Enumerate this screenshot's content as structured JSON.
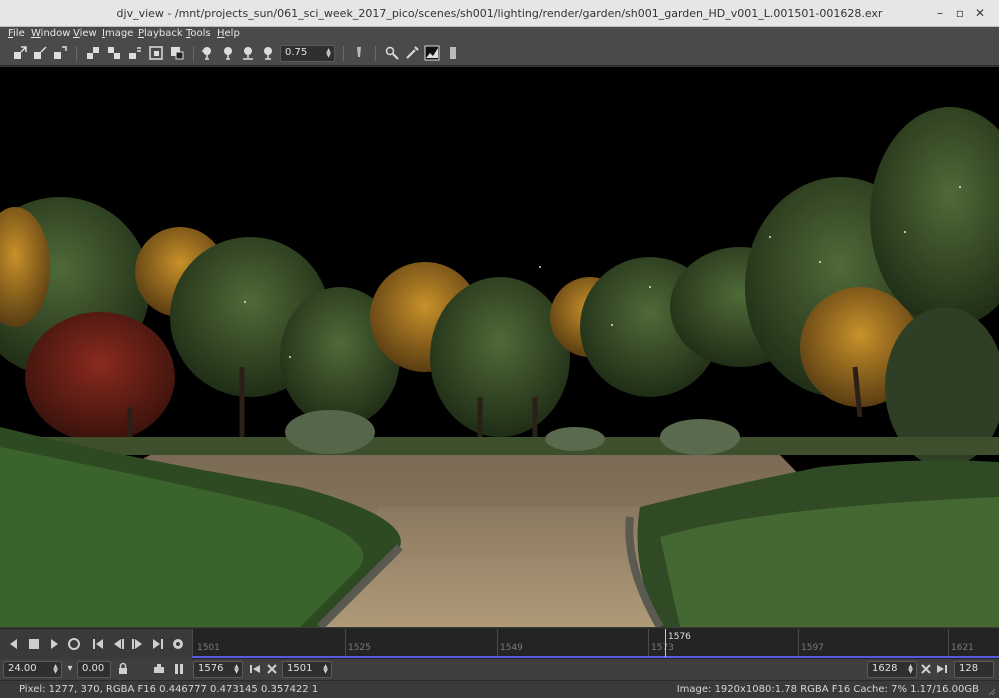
{
  "window": {
    "title": "djv_view - /mnt/projects_sun/061_sci_week_2017_pico/scenes/sh001/lighting/render/garden/sh001_garden_HD_v001_L.001501-001628.exr"
  },
  "menu": [
    {
      "label": "File"
    },
    {
      "label": "Window"
    },
    {
      "label": "View"
    },
    {
      "label": "Image"
    },
    {
      "label": "Playback"
    },
    {
      "label": "Tools"
    },
    {
      "label": "Help"
    }
  ],
  "toolbar": {
    "zoom_value": "0.75"
  },
  "timeline": {
    "current_frame": "1576",
    "ticks": [
      "1501",
      "1525",
      "1549",
      "1573",
      "1597",
      "1621"
    ]
  },
  "controls": {
    "fps": "24.00",
    "speed": "0.00",
    "frame": "1576",
    "in_point": "1501",
    "out_point": "1628",
    "duration": "128"
  },
  "status": {
    "pixel_info": "Pixel: 1277, 370, RGBA F16 0.446777 0.473145 0.357422 1",
    "image_info": "Image: 1920x1080:1.78 RGBA F16 Cache: 7% 1.17/16.00GB"
  },
  "colors": {
    "accent": "#5a5ae0",
    "background": "#3a3a3a"
  }
}
